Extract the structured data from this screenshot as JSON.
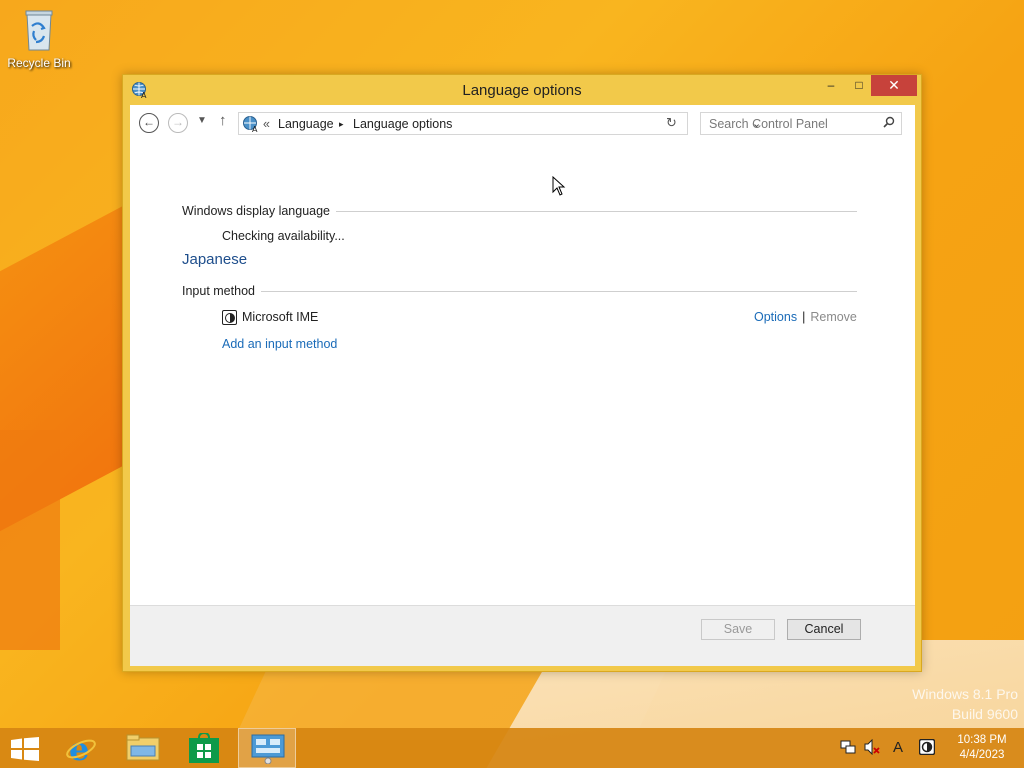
{
  "desktop": {
    "icons": [
      {
        "label": "Recycle Bin",
        "icon": "recycle-bin-icon"
      }
    ],
    "watermark": {
      "line1": "Windows 8.1 Pro",
      "line2": "Build 9600"
    }
  },
  "window": {
    "title": "Language options",
    "icon": "language-globe-icon",
    "controls": {
      "minimize": "–",
      "maximize": "□",
      "close": "✕"
    }
  },
  "address_bar": {
    "prefix": "«",
    "breadcrumbs": [
      "Language",
      "Language options"
    ],
    "separator": "▸",
    "search_placeholder": "Search Control Panel"
  },
  "content": {
    "language_name": "Japanese",
    "display_language": {
      "header": "Windows display language",
      "status": "Checking availability..."
    },
    "input_method": {
      "header": "Input method",
      "items": [
        {
          "name": "Microsoft IME",
          "options_label": "Options",
          "remove_label": "Remove"
        }
      ],
      "add_label": "Add an input method"
    }
  },
  "footer": {
    "save_label": "Save",
    "cancel_label": "Cancel"
  },
  "taskbar": {
    "pinned": [
      {
        "name": "start-icon"
      },
      {
        "name": "internet-explorer-icon"
      },
      {
        "name": "file-explorer-icon"
      },
      {
        "name": "store-icon"
      },
      {
        "name": "control-panel-icon",
        "active": true
      }
    ],
    "tray": {
      "ime_mode": "A"
    },
    "clock": {
      "time": "10:38 PM",
      "date": "4/4/2023"
    }
  }
}
